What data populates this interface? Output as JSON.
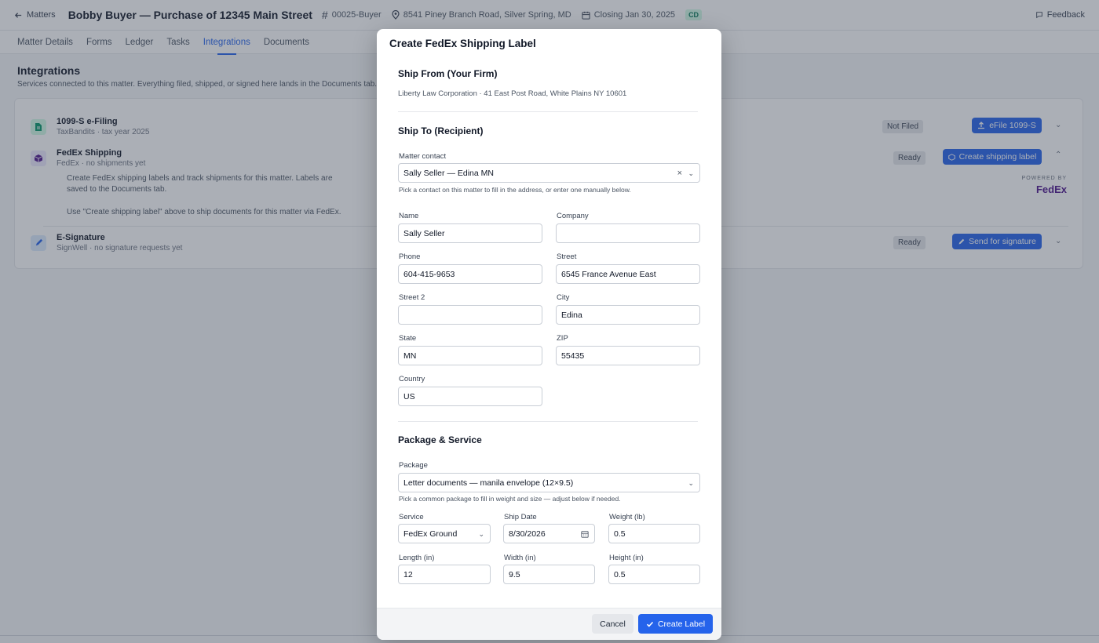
{
  "header": {
    "back_label": "Matters",
    "matter_title": "Bobby Buyer — Purchase of 12345 Main Street",
    "matter_number": "00025-Buyer",
    "address": "8541 Piney Branch Road, Silver Spring, MD",
    "closing": "Closing Jan 30, 2025",
    "initials": "CD",
    "feedback_label": "Feedback"
  },
  "tabs": [
    {
      "label": "Matter Details"
    },
    {
      "label": "Forms"
    },
    {
      "label": "Ledger"
    },
    {
      "label": "Tasks"
    },
    {
      "label": "Integrations"
    },
    {
      "label": "Documents"
    }
  ],
  "integrations": {
    "title": "Integrations",
    "subtitle": "Services connected to this matter. Everything filed, shipped, or signed here lands in the Documents tab.",
    "items": [
      {
        "name": "1099-S e-Filing",
        "sub": "TaxBandits · tax year 2025",
        "status": "Not Filed",
        "action": "eFile 1099-S",
        "icon": "document-icon"
      },
      {
        "name": "FedEx Shipping",
        "sub": "FedEx · no shipments yet",
        "status": "Ready",
        "action": "Create shipping label",
        "icon": "package-icon",
        "desc_line1": "Create FedEx shipping labels and track shipments for this matter. Labels are",
        "desc_line2": "saved to the Documents tab.",
        "desc_line3": "Use \"Create shipping label\" above to ship documents for this matter via FedEx.",
        "powered_by": "POWERED BY",
        "brand": "FedEx"
      },
      {
        "name": "E-Signature",
        "sub": "SignWell · no signature requests yet",
        "status": "Ready",
        "action": "Send for signature",
        "icon": "pencil-icon"
      }
    ]
  },
  "modal": {
    "title": "Create FedEx Shipping Label",
    "ship_from": {
      "heading": "Ship From (Your Firm)",
      "address": "Liberty Law Corporation · 41 East Post Road, White Plains NY 10601"
    },
    "ship_to": {
      "heading": "Ship To (Recipient)",
      "contact_label": "Matter contact",
      "contact_value": "Sally Seller — Edina MN",
      "contact_hint": "Pick a contact on this matter to fill in the address, or enter one manually below.",
      "name_label": "Name",
      "name": "Sally Seller",
      "company_label": "Company",
      "company": "",
      "phone_label": "Phone",
      "phone": "604-415-9653",
      "street_label": "Street",
      "street": "6545 France Avenue East",
      "street2_label": "Street 2",
      "street2": "",
      "city_label": "City",
      "city": "Edina",
      "state_label": "State",
      "state": "MN",
      "zip_label": "ZIP",
      "zip": "55435",
      "country_label": "Country",
      "country": "US"
    },
    "package": {
      "heading": "Package & Service",
      "package_label": "Package",
      "package_value": "Letter documents — manila envelope (12×9.5)",
      "package_hint": "Pick a common package to fill in weight and size — adjust below if needed.",
      "service_label": "Service",
      "service": "FedEx Ground",
      "ship_date_label": "Ship Date",
      "ship_date": "8/30/2026",
      "weight_label": "Weight (lb)",
      "weight": "0.5",
      "length_label": "Length (in)",
      "length": "12",
      "width_label": "Width (in)",
      "width": "9.5",
      "height_label": "Height (in)",
      "height": "0.5"
    },
    "footer": {
      "cancel": "Cancel",
      "create": "Create Label"
    }
  },
  "colors": {
    "accent": "#2563eb",
    "fedex_purple": "#4d148c",
    "success_bg": "#d1fae5"
  }
}
